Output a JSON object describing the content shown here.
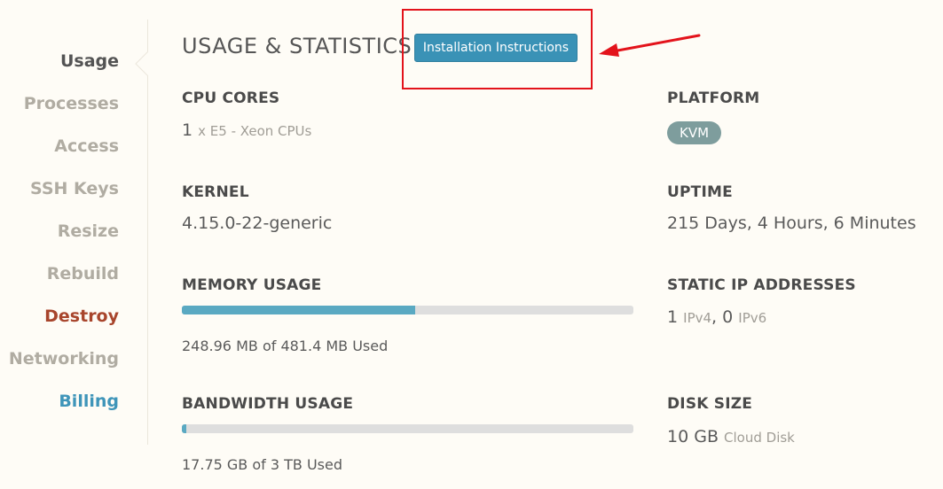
{
  "sidebar": {
    "items": [
      {
        "label": "Usage",
        "state": "active"
      },
      {
        "label": "Processes",
        "state": "normal"
      },
      {
        "label": "Access",
        "state": "normal"
      },
      {
        "label": "SSH Keys",
        "state": "normal"
      },
      {
        "label": "Resize",
        "state": "normal"
      },
      {
        "label": "Rebuild",
        "state": "normal"
      },
      {
        "label": "Destroy",
        "state": "danger"
      },
      {
        "label": "Networking",
        "state": "normal"
      },
      {
        "label": "Billing",
        "state": "link"
      }
    ]
  },
  "header": {
    "title": "USAGE & STATISTICS",
    "install_button_label": "Installation Instructions"
  },
  "stats": {
    "cpu": {
      "label": "CPU CORES",
      "count": "1",
      "detail": "x E5 - Xeon CPUs"
    },
    "platform": {
      "label": "PLATFORM",
      "badge": "KVM"
    },
    "kernel": {
      "label": "KERNEL",
      "value": "4.15.0-22-generic"
    },
    "uptime": {
      "label": "UPTIME",
      "value": "215 Days, 4 Hours, 6 Minutes"
    },
    "memory": {
      "label": "MEMORY USAGE",
      "used_text": "248.96 MB of 481.4 MB Used",
      "fraction": 0.517
    },
    "static_ip": {
      "label": "STATIC IP ADDRESSES",
      "ipv4_count": "1",
      "ipv4_label": "IPv4",
      "separator": ",",
      "ipv6_count": "0",
      "ipv6_label": "IPv6"
    },
    "bandwidth": {
      "label": "BANDWIDTH USAGE",
      "used_text": "17.75 GB of 3 TB Used",
      "fraction": 0.006
    },
    "disk": {
      "label": "DISK SIZE",
      "size": "10 GB",
      "type": "Cloud Disk"
    }
  },
  "colors": {
    "accent": "#3a92b6",
    "danger": "#a8452c",
    "annotation": "#e3131b",
    "badge": "#7e9d9d",
    "bar_fill": "#5aa9c2"
  }
}
